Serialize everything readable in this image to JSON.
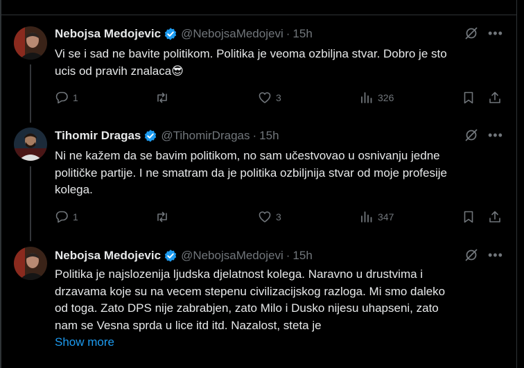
{
  "tweets": [
    {
      "name": "Nebojsa Medojevic",
      "handle": "@NebojsaMedojevi",
      "separator": "·",
      "time": "15h",
      "lines": [
        "Vi se i sad ne bavite politikom. Politika je veoma ozbiljna stvar. Dobro je sto",
        "ucis od pravih znalaca😎"
      ],
      "replies": "1",
      "likes": "3",
      "views": "326"
    },
    {
      "name": "Tihomir Dragas",
      "handle": "@TihomirDragas",
      "separator": "·",
      "time": "15h",
      "lines": [
        "Ni ne kažem da se bavim politikom, no sam učestvovao u osnivanju jedne",
        "političke partije. I ne smatram da je politika ozbiljnija stvar od moje profesije",
        "kolega."
      ],
      "replies": "1",
      "likes": "3",
      "views": "347"
    },
    {
      "name": "Nebojsa Medojevic",
      "handle": "@NebojsaMedojevi",
      "separator": "·",
      "time": "15h",
      "lines": [
        "Politika je najslozenija ljudska djelatnost kolega. Naravno u drustvima i",
        "drzavama koje su na vecem stepenu civilizacijskog razloga. Mi smo daleko",
        "od toga. Zato DPS nije zabrabjen, zato Milo i Dusko nijesu uhapseni, zato",
        "nam se Vesna sprda u lice itd itd. Nazalost, steta je"
      ],
      "show_more": "Show more"
    }
  ],
  "colors": {
    "background": "#000000",
    "text": "#e7e9ea",
    "secondary": "#71767b",
    "accent": "#1d9bf0",
    "border": "#2f3336"
  },
  "icons": {
    "verified": "verified-badge-icon",
    "grok": "grok-icon",
    "more": "more-dots-icon",
    "reply": "reply-icon",
    "retweet": "retweet-icon",
    "like": "heart-icon",
    "views": "views-icon",
    "bookmark": "bookmark-icon",
    "share": "share-icon"
  }
}
